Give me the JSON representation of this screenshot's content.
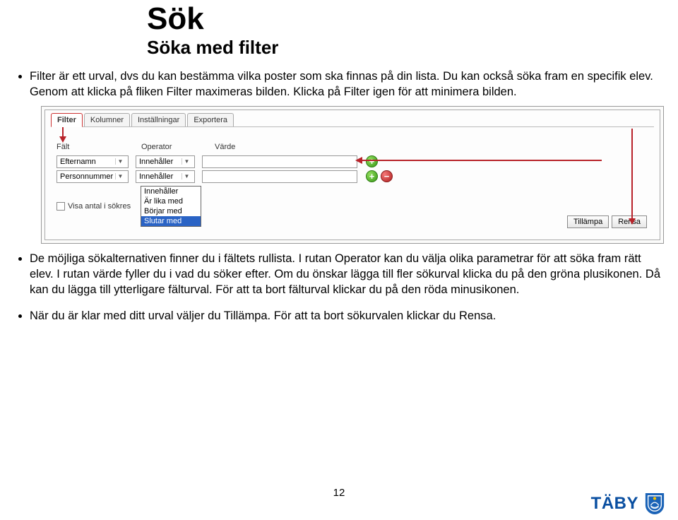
{
  "title": "Sök",
  "subtitle": "Söka med filter",
  "bullets": {
    "p1": "Filter är ett urval, dvs du kan bestämma vilka poster som ska finnas på din lista. Du kan också söka fram en specifik elev. Genom att klicka på fliken Filter maximeras bilden. Klicka på Filter igen för att minimera bilden.",
    "p2": "De möjliga sökalternativen finner du i fältets rullista. I rutan Operator kan du välja olika parametrar för att söka fram rätt elev. I rutan värde fyller du i vad du söker efter. Om du önskar lägga till fler sökurval klicka du på den gröna plusikonen. Då kan du lägga till ytterligare fälturval. För att ta bort fälturval klickar du på den röda minusikonen.",
    "p3": "När du är klar med ditt urval väljer du Tillämpa. För att ta bort sökurvalen klickar du Rensa."
  },
  "tabs": {
    "filter": "Filter",
    "kolumner": "Kolumner",
    "installningar": "Inställningar",
    "exportera": "Exportera"
  },
  "headers": {
    "falt": "Fält",
    "operator": "Operator",
    "varde": "Värde"
  },
  "rows": {
    "r1_field": "Efternamn",
    "r1_op": "Innehåller",
    "r2_field": "Personnummer",
    "r2_op": "Innehåller"
  },
  "dropdown": {
    "o1": "Innehåller",
    "o2": "Är lika med",
    "o3": "Börjar med",
    "o4": "Slutar med"
  },
  "checkbox_label": "Visa antal i sökres",
  "buttons": {
    "apply": "Tillämpa",
    "clear": "Rensa",
    "plus": "+",
    "minus": "−"
  },
  "pagenum": "12",
  "logo": "TÄBY"
}
